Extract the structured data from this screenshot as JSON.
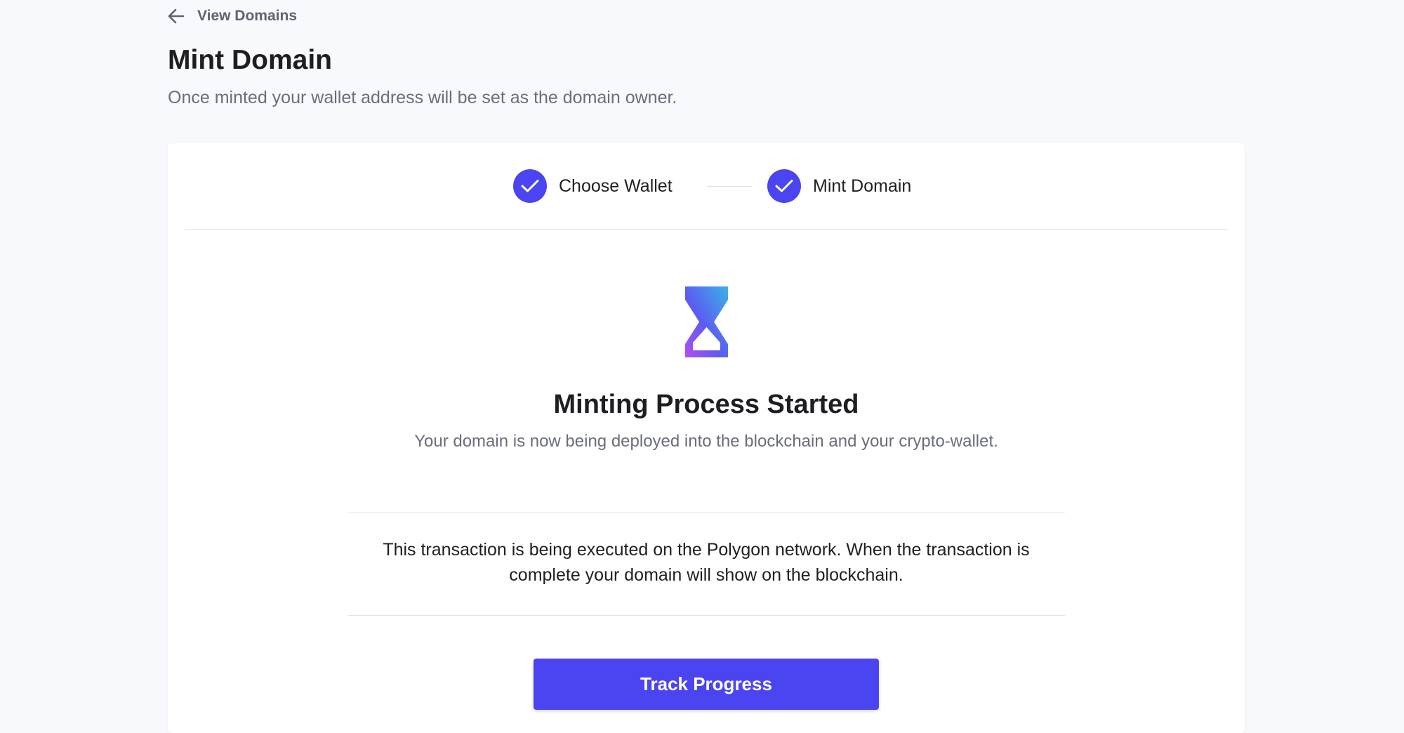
{
  "nav": {
    "back_label": "View Domains",
    "back_icon": "arrow-left-icon"
  },
  "header": {
    "title": "Mint Domain",
    "subtitle": "Once minted your wallet address will be set as the domain owner."
  },
  "stepper": {
    "steps": [
      {
        "label": "Choose Wallet",
        "status": "complete",
        "icon": "check-icon"
      },
      {
        "label": "Mint Domain",
        "status": "complete",
        "icon": "check-icon"
      }
    ]
  },
  "status": {
    "icon": "hourglass-icon",
    "title": "Minting Process Started",
    "subtitle": "Your domain is now being deployed into the blockchain and your crypto-wallet.",
    "network_note": "This transaction is being executed on the Polygon network. When the transaction is complete your domain will show on the blockchain."
  },
  "actions": {
    "track_label": "Track Progress"
  },
  "colors": {
    "accent": "#4a45f0",
    "background": "#f8f9fd",
    "muted_text": "#6a6d7c",
    "gradient_start": "#3ab4e6",
    "gradient_end": "#b34df0"
  }
}
